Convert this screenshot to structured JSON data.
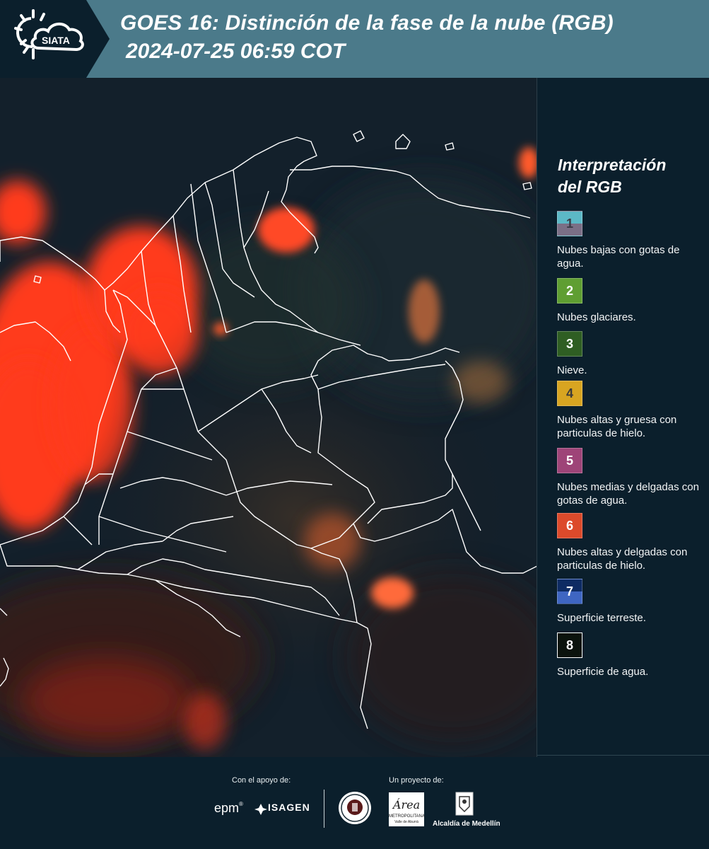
{
  "header": {
    "logo_text": "SIATA",
    "title": "GOES 16: Distinción de la fase de la nube (RGB)",
    "datetime": "2024-07-25 06:59 COT"
  },
  "legend": {
    "title_line1": "Interpretación",
    "title_line2": "del RGB",
    "items": [
      {
        "num": "1",
        "label": "Nubes bajas con gotas de agua.",
        "color_top": "#5cb8c6",
        "color_bottom": "#7b6f86",
        "num_color": "#3b3b46"
      },
      {
        "num": "2",
        "label": "Nubes glaciares.",
        "color": "#5f9e32",
        "num_color": "#ffffff"
      },
      {
        "num": "3",
        "label": "Nieve.",
        "color": "#2f5e23",
        "num_color": "#ffffff"
      },
      {
        "num": "4",
        "label": "Nubes altas y gruesa con particulas de hielo.",
        "color": "#d8a521",
        "num_color": "#3a3a3a"
      },
      {
        "num": "5",
        "label": "Nubes medias y delgadas con gotas de agua.",
        "color": "#9e4478",
        "num_color": "#ffffff"
      },
      {
        "num": "6",
        "label": "Nubes altas y delgadas con particulas de hielo.",
        "color": "#dc4a2b",
        "num_color": "#ffffff"
      },
      {
        "num": "7",
        "label": "Superficie terreste.",
        "color_top": "#0e2b63",
        "color_bottom": "#3f66c2",
        "num_color": "#ffffff"
      },
      {
        "num": "8",
        "label": "Superficie de agua.",
        "color": "#0b130d",
        "num_color": "#ffffff"
      }
    ]
  },
  "footer": {
    "support_label": "Con el apoyo de:",
    "project_label": "Un proyecto de:",
    "sponsor_epm": "epm",
    "sponsor_isagen": "ISAGEN",
    "area_metropolitana": "METROPOLITANA",
    "area_sub": "Valle de Aburrá",
    "area_word": "Área",
    "alcaldia": "Alcaldía de Medellín"
  },
  "colors": {
    "header_bg": "#4b7a8a",
    "panel_bg": "#0b1f2c",
    "cloud_red": "#ff3a1e"
  }
}
